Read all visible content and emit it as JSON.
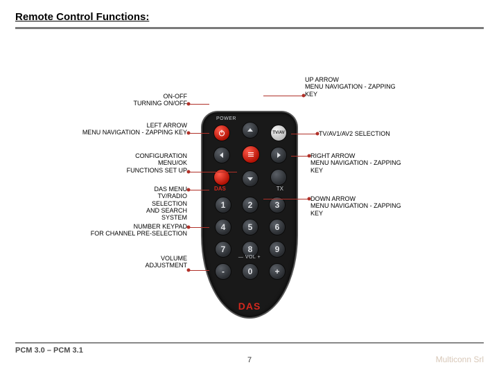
{
  "title": "Remote Control Functions:",
  "remote": {
    "power_label": "POWER",
    "das_label": "DAS",
    "tx_label": "TX",
    "tvav_label": "TV/AV",
    "vol_label": "— VOL +",
    "brand": "DAS",
    "keypad": [
      "1",
      "2",
      "3",
      "4",
      "5",
      "6",
      "7",
      "8",
      "9",
      "-",
      "0",
      "+"
    ]
  },
  "labels": {
    "onoff_l1": "ON-OFF",
    "onoff_l2": "TURNING ON/OFF",
    "left_l1": "LEFT ARROW",
    "left_l2": "MENU NAVIGATION - ZAPPING KEY",
    "cfg_l1": "CONFIGURATION",
    "cfg_l2": "MENU/OK",
    "cfg_l3": "FUNCTIONS SET UP",
    "das_l1": "DAS MENU",
    "das_l2": "TV/RADIO",
    "das_l3": "SELECTION",
    "das_l4": "AND SEARCH",
    "das_l5": "SYSTEM",
    "num_l1": "NUMBER KEYPAD",
    "num_l2": "FOR CHANNEL PRE-SELECTION",
    "vol_l1": "VOLUME",
    "vol_l2": "ADJUSTMENT",
    "up_l1": "UP ARROW",
    "up_l2": "MENU NAVIGATION - ZAPPING",
    "up_l3": "KEY",
    "tvav_l1": "TV/AV1/AV2 SELECTION",
    "right_l1": "RIGHT ARROW",
    "right_l2": "MENU NAVIGATION - ZAPPING",
    "right_l3": "KEY",
    "down_l1": "DOWN ARROW",
    "down_l2": "MENU NAVIGATION - ZAPPING",
    "down_l3": "KEY"
  },
  "footer": {
    "left": "PCM 3.0 – PCM 3.1",
    "page": "7",
    "right": "Multiconn Srl"
  }
}
